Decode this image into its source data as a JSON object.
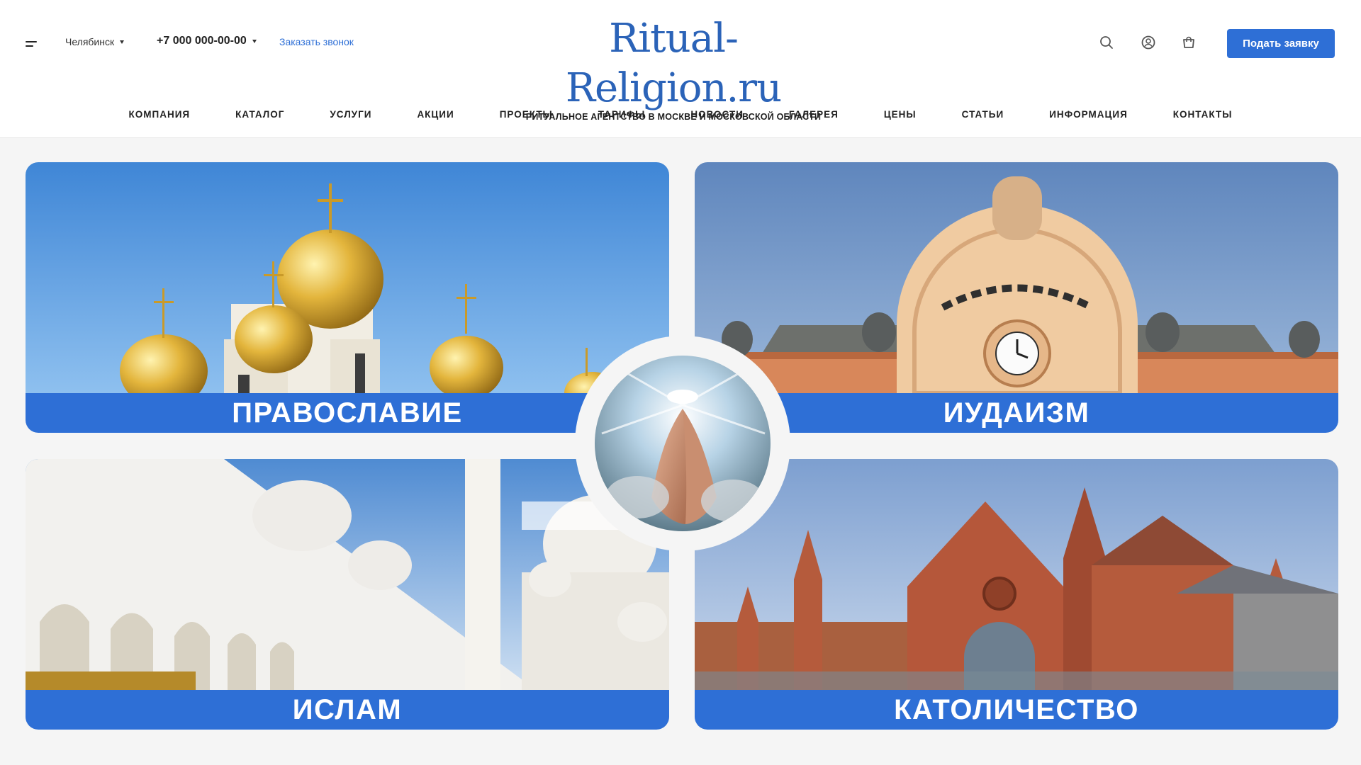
{
  "header": {
    "city": "Челябинск",
    "phone": "+7 000 000-00-00",
    "callback": "Заказать звонок",
    "logo": "Ritual-Religion.ru",
    "tagline": "РИТУАЛЬНОЕ АГЕНТСТВО В МОСКВЕ И МОСКОВСКОЙ ОБЛАСТИ",
    "cta": "Подать заявку",
    "icons": [
      "menu-icon",
      "search-icon",
      "user-icon",
      "cart-icon"
    ]
  },
  "nav": {
    "items": [
      "КОМПАНИЯ",
      "КАТАЛОГ",
      "УСЛУГИ",
      "АКЦИИ",
      "ПРОЕКТЫ",
      "ТАРИФЫ",
      "НОВОСТИ",
      "ГАЛЕРЕЯ",
      "ЦЕНЫ",
      "СТАТЬИ",
      "ИНФОРМАЦИЯ",
      "КОНТАКТЫ"
    ]
  },
  "religions": [
    {
      "label": "ПРАВОСЛАВИЕ",
      "image": "orthodox-church-domes"
    },
    {
      "label": "ИУДАИЗМ",
      "image": "synagogue-facade"
    },
    {
      "label": "ИСЛАМ",
      "image": "white-mosque"
    },
    {
      "label": "КАТОЛИЧЕСТВО",
      "image": "red-brick-cathedral"
    }
  ],
  "center": {
    "image": "praying-hands"
  },
  "colors": {
    "accent": "#2e6fd6",
    "logo": "#2b63b8",
    "background": "#f5f5f5"
  }
}
